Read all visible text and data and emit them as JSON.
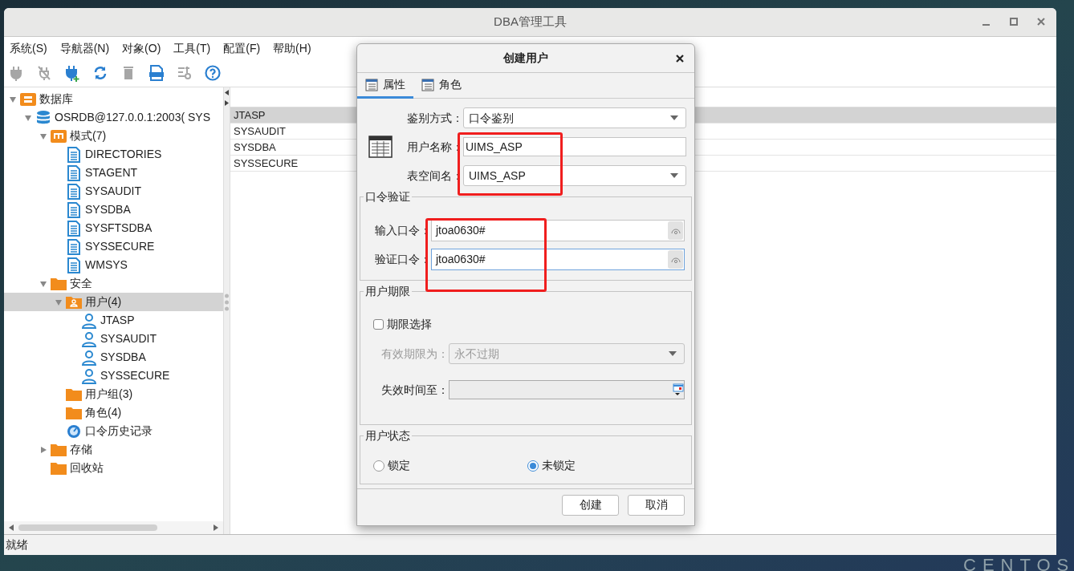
{
  "window": {
    "title": "DBA管理工具"
  },
  "menu": [
    "系统(S)",
    "导航器(N)",
    "对象(O)",
    "工具(T)",
    "配置(F)",
    "帮助(H)"
  ],
  "toolbar": [
    {
      "kind": "plug",
      "disabled": true
    },
    {
      "kind": "unplug",
      "disabled": true
    },
    {
      "kind": "plug-add",
      "disabled": false
    },
    {
      "kind": "refresh",
      "disabled": false
    },
    {
      "kind": "trash",
      "disabled": true
    },
    {
      "kind": "obj",
      "disabled": false
    },
    {
      "kind": "tools",
      "disabled": true
    },
    {
      "kind": "help",
      "disabled": false
    }
  ],
  "tree": [
    {
      "label": "数据库",
      "kind": "database",
      "expanded": true,
      "selected": false,
      "children": [
        {
          "label": "OSRDB@127.0.0.1:2003( SYS",
          "kind": "server",
          "expanded": true,
          "selected": false,
          "children": [
            {
              "label": "模式(7)",
              "kind": "schema",
              "expanded": true,
              "selected": false,
              "children": [
                {
                  "label": "DIRECTORIES",
                  "kind": "doc",
                  "selected": false
                },
                {
                  "label": "STAGENT",
                  "kind": "doc",
                  "selected": false
                },
                {
                  "label": "SYSAUDIT",
                  "kind": "doc",
                  "selected": false
                },
                {
                  "label": "SYSDBA",
                  "kind": "doc",
                  "selected": false
                },
                {
                  "label": "SYSFTSDBA",
                  "kind": "doc",
                  "selected": false
                },
                {
                  "label": "SYSSECURE",
                  "kind": "doc",
                  "selected": false
                },
                {
                  "label": "WMSYS",
                  "kind": "doc",
                  "selected": false
                }
              ]
            },
            {
              "label": "安全",
              "kind": "folder",
              "expanded": true,
              "selected": false,
              "children": [
                {
                  "label": "用户(4)",
                  "kind": "user-folder",
                  "expanded": true,
                  "selected": true,
                  "children": [
                    {
                      "label": "JTASP",
                      "kind": "user",
                      "selected": false
                    },
                    {
                      "label": "SYSAUDIT",
                      "kind": "user",
                      "selected": false
                    },
                    {
                      "label": "SYSDBA",
                      "kind": "user",
                      "selected": false
                    },
                    {
                      "label": "SYSSECURE",
                      "kind": "user",
                      "selected": false
                    }
                  ]
                },
                {
                  "label": "用户组(3)",
                  "kind": "folder",
                  "selected": false
                },
                {
                  "label": "角色(4)",
                  "kind": "folder",
                  "selected": false
                },
                {
                  "label": "口令历史记录",
                  "kind": "history",
                  "selected": false
                }
              ]
            },
            {
              "label": "存储",
              "kind": "folder",
              "expanded": false,
              "selected": false
            },
            {
              "label": "回收站",
              "kind": "folder",
              "selected": false
            }
          ]
        }
      ]
    }
  ],
  "list": [
    {
      "text": "JTASP",
      "selected": true
    },
    {
      "text": "SYSAUDIT",
      "selected": false
    },
    {
      "text": "SYSDBA",
      "selected": false
    },
    {
      "text": "SYSSECURE",
      "selected": false
    }
  ],
  "status_bar": "就绪",
  "dialog": {
    "title": "创建用户",
    "tabs": [
      {
        "label": "属性",
        "selected": true
      },
      {
        "label": "角色",
        "selected": false
      }
    ],
    "auth": {
      "label": "鉴别方式：",
      "value": "口令鉴别"
    },
    "username": {
      "label": "用户名称：",
      "value": "UIMS_ASP"
    },
    "tablespace": {
      "label": "表空间名：",
      "value": "UIMS_ASP"
    },
    "password_group": {
      "title": "口令验证",
      "password": {
        "label": "输入口令：",
        "value": "jtoa0630#"
      },
      "confirm": {
        "label": "验证口令：",
        "value": "jtoa0630#"
      }
    },
    "expiry_group": {
      "title": "用户期限",
      "checkbox": {
        "label": "期限选择",
        "checked": false
      },
      "validity": {
        "label": "有效期限为：",
        "value": "永不过期",
        "disabled": true
      },
      "expire_at": {
        "label": "失效时间至："
      }
    },
    "state_group": {
      "title": "用户状态",
      "options": [
        {
          "label": "锁定",
          "selected": false
        },
        {
          "label": "未锁定",
          "selected": true
        }
      ]
    },
    "buttons": [
      "创建",
      "取消"
    ]
  },
  "desktop_label": "CENTOS"
}
